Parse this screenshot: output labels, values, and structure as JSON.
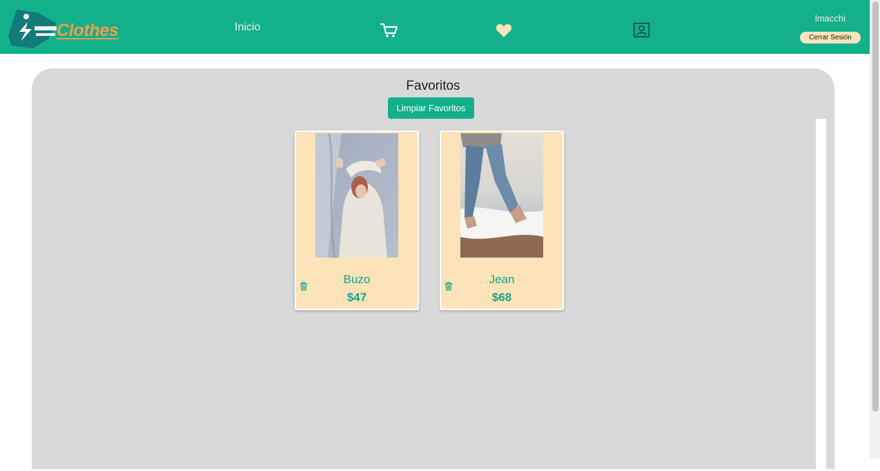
{
  "header": {
    "brand": "Clothes",
    "nav_home": "Inicio",
    "icons": [
      "cart-icon",
      "heart-icon",
      "profile-icon"
    ],
    "username": "lmacchi",
    "logout_label": "Cerrar Sesión"
  },
  "favorites": {
    "title": "Favoritos",
    "clear_label": "Limpiar Favoritos",
    "items": [
      {
        "name": "Buzo",
        "price": "$47"
      },
      {
        "name": "Jean",
        "price": "$68"
      }
    ]
  },
  "colors": {
    "brand": "#13b08c",
    "logo_text": "#f39b4c",
    "card_bg": "#fde3b8",
    "panel_bg": "#d9d9d9"
  }
}
